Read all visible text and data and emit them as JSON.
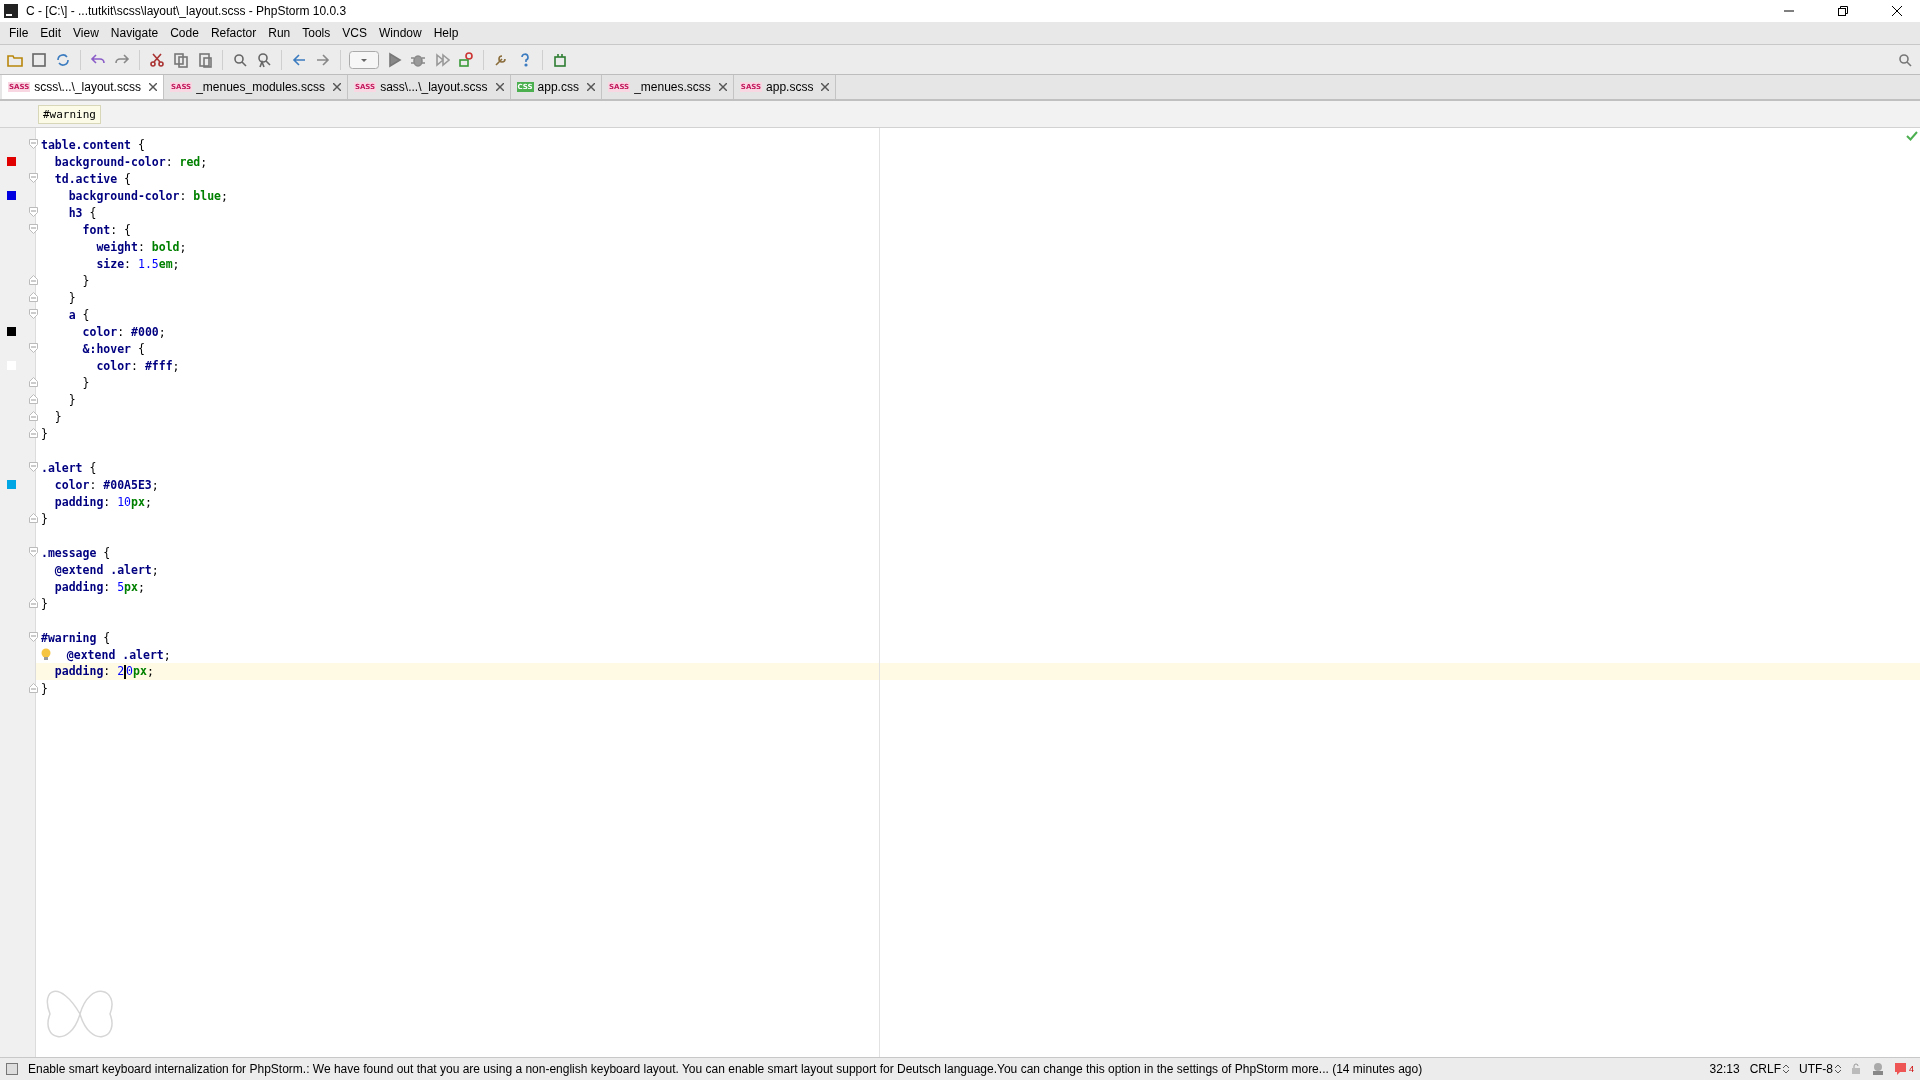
{
  "window": {
    "title": "C - [C:\\] - ...tutkit\\scss\\layout\\_layout.scss - PhpStorm 10.0.3"
  },
  "menu": [
    "File",
    "Edit",
    "View",
    "Navigate",
    "Code",
    "Refactor",
    "Run",
    "Tools",
    "VCS",
    "Window",
    "Help"
  ],
  "tabs": [
    {
      "label": "scss\\...\\_layout.scss",
      "badge": "SASS",
      "kind": "sass",
      "selected": true
    },
    {
      "label": "_menues_modules.scss",
      "badge": "SASS",
      "kind": "sass",
      "selected": false
    },
    {
      "label": "sass\\...\\_layout.scss",
      "badge": "SASS",
      "kind": "sass",
      "selected": false
    },
    {
      "label": "app.css",
      "badge": "CSS",
      "kind": "css",
      "selected": false
    },
    {
      "label": "_menues.scss",
      "badge": "SASS",
      "kind": "sass",
      "selected": false
    },
    {
      "label": "app.scss",
      "badge": "SASS",
      "kind": "sass",
      "selected": false
    }
  ],
  "breadcrumb": "#warning",
  "lines": [
    {
      "kind": "fold-open",
      "tokens": [
        {
          "text": "table.content",
          "kind": "sel"
        },
        {
          "text": " {",
          "kind": "p"
        }
      ]
    },
    {
      "kind": "plain",
      "color": "#e00000",
      "tokens": [
        {
          "text": "  background-color",
          "kind": "prop"
        },
        {
          "text": ": ",
          "kind": "p"
        },
        {
          "text": "red",
          "kind": "val"
        },
        {
          "text": ";",
          "kind": "p"
        }
      ]
    },
    {
      "kind": "fold-open",
      "tokens": [
        {
          "text": "  td.active",
          "kind": "sel"
        },
        {
          "text": " {",
          "kind": "p"
        }
      ]
    },
    {
      "kind": "plain",
      "color": "#0000e0",
      "tokens": [
        {
          "text": "    background-color",
          "kind": "prop"
        },
        {
          "text": ": ",
          "kind": "p"
        },
        {
          "text": "blue",
          "kind": "val"
        },
        {
          "text": ";",
          "kind": "p"
        }
      ]
    },
    {
      "kind": "fold-open",
      "tokens": [
        {
          "text": "    h3",
          "kind": "sel"
        },
        {
          "text": " {",
          "kind": "p"
        }
      ]
    },
    {
      "kind": "fold-open",
      "tokens": [
        {
          "text": "      font",
          "kind": "prop"
        },
        {
          "text": ": {",
          "kind": "p"
        }
      ]
    },
    {
      "kind": "plain",
      "tokens": [
        {
          "text": "        weight",
          "kind": "prop"
        },
        {
          "text": ": ",
          "kind": "p"
        },
        {
          "text": "bold",
          "kind": "val"
        },
        {
          "text": ";",
          "kind": "p"
        }
      ]
    },
    {
      "kind": "plain",
      "tokens": [
        {
          "text": "        size",
          "kind": "prop"
        },
        {
          "text": ": ",
          "kind": "p"
        },
        {
          "text": "1.5",
          "kind": "num"
        },
        {
          "text": "em",
          "kind": "val"
        },
        {
          "text": ";",
          "kind": "p"
        }
      ]
    },
    {
      "kind": "fold-close",
      "tokens": [
        {
          "text": "      }",
          "kind": "p"
        }
      ]
    },
    {
      "kind": "fold-close",
      "tokens": [
        {
          "text": "    }",
          "kind": "p"
        }
      ]
    },
    {
      "kind": "fold-open",
      "tokens": [
        {
          "text": "    a",
          "kind": "sel"
        },
        {
          "text": " {",
          "kind": "p"
        }
      ]
    },
    {
      "kind": "plain",
      "color": "#000000",
      "tokens": [
        {
          "text": "      color",
          "kind": "prop"
        },
        {
          "text": ": ",
          "kind": "p"
        },
        {
          "text": "#000",
          "kind": "hex"
        },
        {
          "text": ";",
          "kind": "p"
        }
      ]
    },
    {
      "kind": "fold-open",
      "tokens": [
        {
          "text": "      &:hover",
          "kind": "sel"
        },
        {
          "text": " {",
          "kind": "p"
        }
      ]
    },
    {
      "kind": "plain",
      "color": "#ffffff",
      "tokens": [
        {
          "text": "        color",
          "kind": "prop"
        },
        {
          "text": ": ",
          "kind": "p"
        },
        {
          "text": "#fff",
          "kind": "hex"
        },
        {
          "text": ";",
          "kind": "p"
        }
      ]
    },
    {
      "kind": "fold-close",
      "tokens": [
        {
          "text": "      }",
          "kind": "p"
        }
      ]
    },
    {
      "kind": "fold-close",
      "tokens": [
        {
          "text": "    }",
          "kind": "p"
        }
      ]
    },
    {
      "kind": "fold-close",
      "tokens": [
        {
          "text": "  }",
          "kind": "p"
        }
      ]
    },
    {
      "kind": "fold-close",
      "tokens": [
        {
          "text": "}",
          "kind": "p"
        }
      ]
    },
    {
      "kind": "blank"
    },
    {
      "kind": "fold-open",
      "tokens": [
        {
          "text": ".alert",
          "kind": "sel"
        },
        {
          "text": " {",
          "kind": "p"
        }
      ]
    },
    {
      "kind": "plain",
      "color": "#00a5e3",
      "tokens": [
        {
          "text": "  color",
          "kind": "prop"
        },
        {
          "text": ": ",
          "kind": "p"
        },
        {
          "text": "#00A5E3",
          "kind": "hex"
        },
        {
          "text": ";",
          "kind": "p"
        }
      ]
    },
    {
      "kind": "plain",
      "tokens": [
        {
          "text": "  padding",
          "kind": "prop"
        },
        {
          "text": ": ",
          "kind": "p"
        },
        {
          "text": "10",
          "kind": "num"
        },
        {
          "text": "px",
          "kind": "val"
        },
        {
          "text": ";",
          "kind": "p"
        }
      ]
    },
    {
      "kind": "fold-close",
      "tokens": [
        {
          "text": "}",
          "kind": "p"
        }
      ]
    },
    {
      "kind": "blank"
    },
    {
      "kind": "fold-open",
      "tokens": [
        {
          "text": ".message",
          "kind": "sel"
        },
        {
          "text": " {",
          "kind": "p"
        }
      ]
    },
    {
      "kind": "plain",
      "tokens": [
        {
          "text": "  @extend .alert",
          "kind": "prop"
        },
        {
          "text": ";",
          "kind": "p"
        }
      ]
    },
    {
      "kind": "plain",
      "tokens": [
        {
          "text": "  padding",
          "kind": "prop"
        },
        {
          "text": ": ",
          "kind": "p"
        },
        {
          "text": "5",
          "kind": "num"
        },
        {
          "text": "px",
          "kind": "val"
        },
        {
          "text": ";",
          "kind": "p"
        }
      ]
    },
    {
      "kind": "fold-close",
      "tokens": [
        {
          "text": "}",
          "kind": "p"
        }
      ]
    },
    {
      "kind": "blank"
    },
    {
      "kind": "fold-open",
      "tokens": [
        {
          "text": "#warning",
          "kind": "sel"
        },
        {
          "text": " {",
          "kind": "p"
        }
      ]
    },
    {
      "kind": "plain",
      "bulb": true,
      "tokens": [
        {
          "text": "  @extend .alert",
          "kind": "prop"
        },
        {
          "text": ";",
          "kind": "p"
        }
      ]
    },
    {
      "kind": "plain",
      "current": true,
      "tokens": [
        {
          "text": "  padding",
          "kind": "prop"
        },
        {
          "text": ": ",
          "kind": "p"
        },
        {
          "text": "2",
          "kind": "num",
          "caret": true
        },
        {
          "text": "0",
          "kind": "num"
        },
        {
          "text": "px",
          "kind": "val"
        },
        {
          "text": ";",
          "kind": "p"
        }
      ]
    },
    {
      "kind": "fold-close",
      "tokens": [
        {
          "text": "}",
          "kind": "p"
        }
      ]
    }
  ],
  "status_bar": {
    "message": "Enable smart keyboard internalization for PhpStorm.: We have found out that you are using a non-english keyboard layout. You can enable smart layout support for Deutsch language.You can change this option in the settings of PhpStorm more... (14 minutes ago)",
    "position": "32:13",
    "line_separator": "CRLF",
    "encoding": "UTF-8",
    "events": "4"
  }
}
